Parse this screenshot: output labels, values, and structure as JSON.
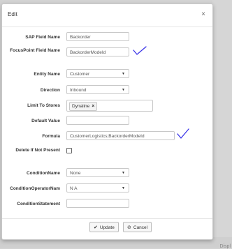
{
  "background": {
    "footer_text": "Displ"
  },
  "modal": {
    "title": "Edit",
    "close_icon": "close-icon",
    "fields": {
      "sap_field_name": {
        "label": "SAP Field Name",
        "value": "Backorder"
      },
      "focuspoint_field_name": {
        "label": "FocusPoint Field Name",
        "value": "BackorderModeId"
      },
      "entity_name": {
        "label": "Entity Name",
        "value": "Customer"
      },
      "direction": {
        "label": "Direction",
        "value": "Inbound"
      },
      "limit_to_stores": {
        "label": "Limit To Stores",
        "tag": "Dynaline",
        "tag_remove": "×"
      },
      "default_value": {
        "label": "Default Value",
        "value": ""
      },
      "formula": {
        "label": "Formula",
        "value": "CustomerLogistics;BackorderModeId"
      },
      "delete_if_not_present": {
        "label": "Delete If Not Present",
        "checked": false
      },
      "condition_name": {
        "label": "ConditionName",
        "value": "None"
      },
      "condition_operator_name": {
        "label": "ConditionOperatorNam",
        "value": "N A"
      },
      "condition_statement": {
        "label": "ConditionStatement",
        "value": ""
      }
    },
    "footer": {
      "update_label": "Update",
      "cancel_label": "Cancel"
    },
    "annotation_color": "#3b35e8"
  }
}
